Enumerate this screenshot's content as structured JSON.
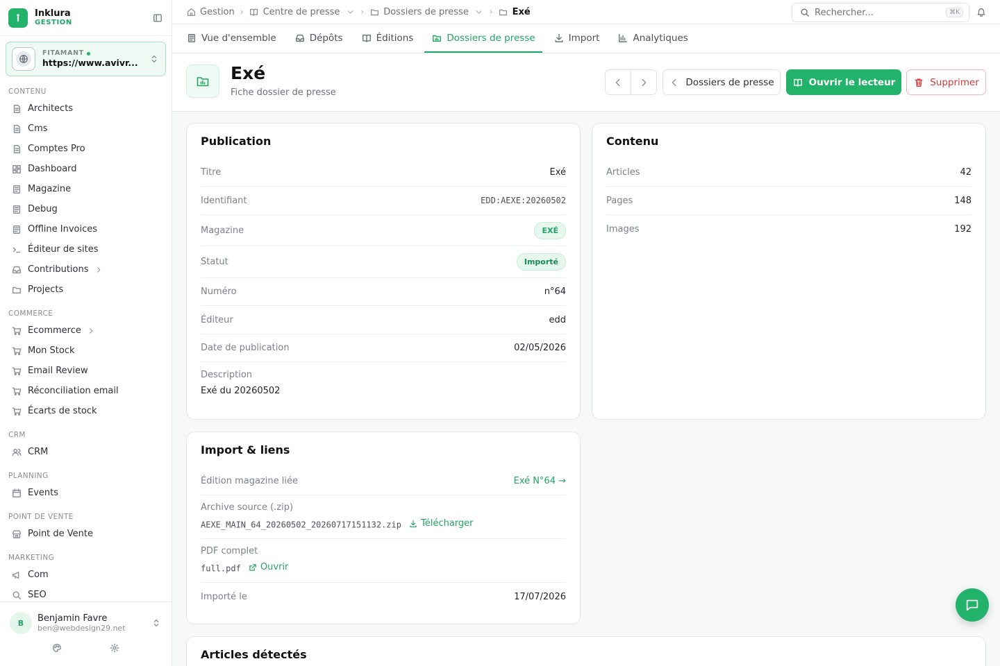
{
  "brand": {
    "name": "Inklura",
    "sub": "GESTION"
  },
  "site": {
    "label": "FITAMANT",
    "url": "https://www.avivr..."
  },
  "sidebar": {
    "sections": {
      "contenu": "CONTENU",
      "commerce": "COMMERCE",
      "crm": "CRM",
      "planning": "PLANNING",
      "pos": "POINT DE VENTE",
      "marketing": "MARKETING"
    },
    "contenu": [
      "Architects",
      "Cms",
      "Comptes Pro",
      "Dashboard",
      "Magazine",
      "Debug",
      "Offline Invoices",
      "Éditeur de sites",
      "Contributions",
      "Projects"
    ],
    "commerce": [
      "Ecommerce",
      "Mon Stock",
      "Email Review",
      "Réconciliation email",
      "Écarts de stock"
    ],
    "crm": [
      "CRM"
    ],
    "planning": [
      "Events"
    ],
    "pos": [
      "Point de Vente"
    ],
    "marketing": [
      "Com",
      "SEO"
    ]
  },
  "user": {
    "initial": "B",
    "name": "Benjamin Favre",
    "email": "ben@webdesign29.net"
  },
  "breadcrumb": {
    "home": "Gestion",
    "press": "Centre de presse",
    "folders": "Dossiers de presse",
    "current": "Exé"
  },
  "search": {
    "placeholder": "Rechercher...",
    "shortcut": "⌘K"
  },
  "tabs": [
    "Vue d'ensemble",
    "Dépôts",
    "Éditions",
    "Dossiers de presse",
    "Import",
    "Analytiques"
  ],
  "header": {
    "title": "Exé",
    "subtitle": "Fiche dossier de presse",
    "back_label": "Dossiers de presse",
    "reader_label": "Ouvrir le lecteur",
    "delete_label": "Supprimer"
  },
  "publication": {
    "title": "Publication",
    "titre_label": "Titre",
    "titre": "Exé",
    "id_label": "Identifiant",
    "id": "EDD:AEXE:20260502",
    "magazine_label": "Magazine",
    "magazine": "EXÉ",
    "statut_label": "Statut",
    "statut": "Importé",
    "numero_label": "Numéro",
    "numero": "n°64",
    "editeur_label": "Éditeur",
    "editeur": "edd",
    "date_label": "Date de publication",
    "date": "02/05/2026",
    "desc_label": "Description",
    "desc": "Exé du 20260502"
  },
  "contenu": {
    "title": "Contenu",
    "articles_label": "Articles",
    "articles": "42",
    "pages_label": "Pages",
    "pages": "148",
    "images_label": "Images",
    "images": "192"
  },
  "import": {
    "title": "Import & liens",
    "edition_label": "Édition magazine liée",
    "edition": "Exé N°64 →",
    "archive_label": "Archive source (.zip)",
    "archive": "AEXE_MAIN_64_20260502_20260717151132.zip",
    "download": "Télécharger",
    "pdf_label": "PDF complet",
    "pdf": "full.pdf",
    "open": "Ouvrir",
    "imported_label": "Importé le",
    "imported": "17/07/2026"
  },
  "articles": {
    "title": "Articles détectés"
  },
  "colors": {
    "accent": "#22b26a",
    "danger": "#d43a3a"
  }
}
